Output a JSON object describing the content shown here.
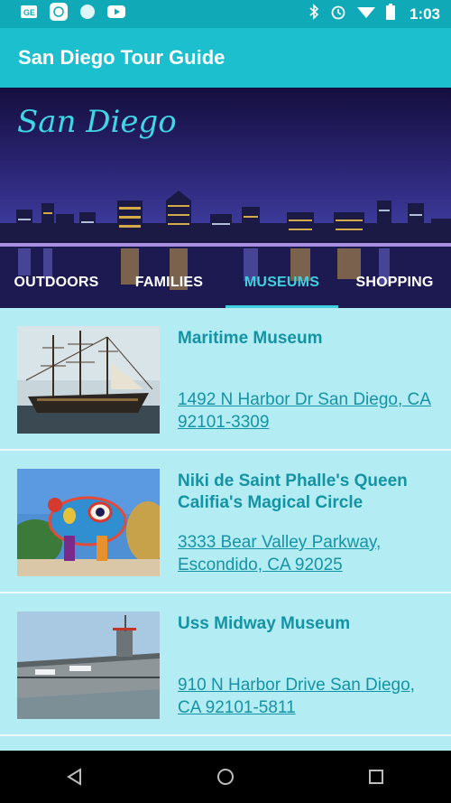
{
  "status_bar": {
    "time": "1:03",
    "left_icons": [
      "ge-news-icon",
      "ebay-icon",
      "circle-app-icon",
      "youtube-icon"
    ],
    "right_icons": [
      "bluetooth-icon",
      "alarm-icon",
      "wifi-icon",
      "battery-icon"
    ]
  },
  "app_bar": {
    "title": "San Diego Tour Guide"
  },
  "hero": {
    "script_title": "San Diego"
  },
  "tabs": [
    {
      "label": "OUTDOORS",
      "active": false
    },
    {
      "label": "FAMILIES",
      "active": false
    },
    {
      "label": "MUSEUMS",
      "active": true
    },
    {
      "label": "SHOPPING",
      "active": false
    }
  ],
  "places": [
    {
      "name": "Maritime Museum",
      "address": "1492 N Harbor Dr San Diego, CA 92101-3309",
      "image": "tall-ship-photo"
    },
    {
      "name": "Niki de Saint Phalle's Queen Califia's Magical Circle",
      "address": "3333 Bear Valley Parkway, Escondido, CA 92025",
      "image": "mosaic-sculpture-photo"
    },
    {
      "name": "Uss Midway Museum",
      "address": "910 N Harbor Drive San Diego, CA 92101-5811",
      "image": "aircraft-carrier-photo"
    }
  ],
  "colors": {
    "status_bar": "#10a9b8",
    "app_bar": "#1bbfce",
    "accent": "#40d0e0",
    "list_background": "#b3ecf2",
    "title_text": "#1493a5"
  }
}
